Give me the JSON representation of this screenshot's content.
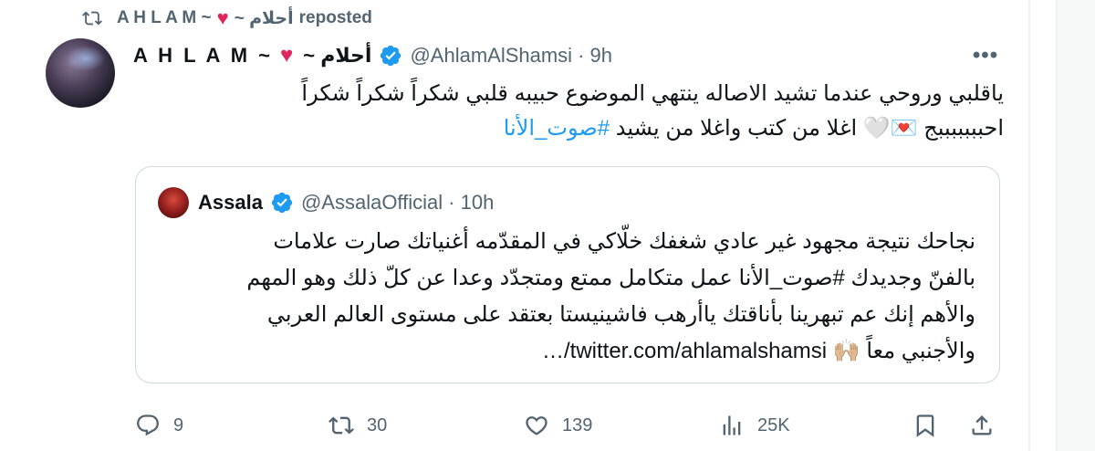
{
  "repost": {
    "user": "A H L A M ~",
    "user_suffix": "~ أحلام",
    "label": "reposted"
  },
  "tweet": {
    "display_name": "A H L A M ~",
    "display_name_suffix": "~ أحلام",
    "handle": "@AhlamAlShamsi",
    "time": "· 9h",
    "more_label": "•••",
    "body_line1": "ياقلبي وروحي عندما تشيد الاصاله ينتهي الموضوع حبيبه قلبي شكراً شكراً شكراً",
    "body_line2_prefix": "احبببببببج 💌🤍 اغلا من كتب واغلا من يشيد ",
    "body_hashtag": "#صوت_الأنا"
  },
  "quote": {
    "display_name": "Assala",
    "handle": "@AssalaOfficial",
    "time": "· 10h",
    "line1": "نجاحك نتيجة مجهود غير عادي شغفك خلّاكي في المقدّمه أغنياتك صارت علامات",
    "line2": "بالفنّ وجديدك #صوت_الأنا عمل متكامل ممتع ومتجدّد وعدا عن كلّ ذلك وهو المهم",
    "line3": "والأهم إنك عم تبهرينا بأناقتك ياأرهب فاشينيستا بعتقد على مستوى العالم العربي",
    "line4": "والأجنبي معاً 🙌🏼 twitter.com/ahlamalshamsi/…"
  },
  "actions": {
    "replies": "9",
    "reposts": "30",
    "likes": "139",
    "views": "25K"
  },
  "colors": {
    "accent": "#1d9bf0",
    "muted": "#536471",
    "heart": "#e0245e",
    "border": "#cfd9de"
  },
  "icons": [
    "repost-icon",
    "verified-badge-icon",
    "more-icon",
    "reply-icon",
    "retweet-icon",
    "like-icon",
    "views-icon",
    "bookmark-icon",
    "share-icon",
    "heart-emoji-icon"
  ]
}
